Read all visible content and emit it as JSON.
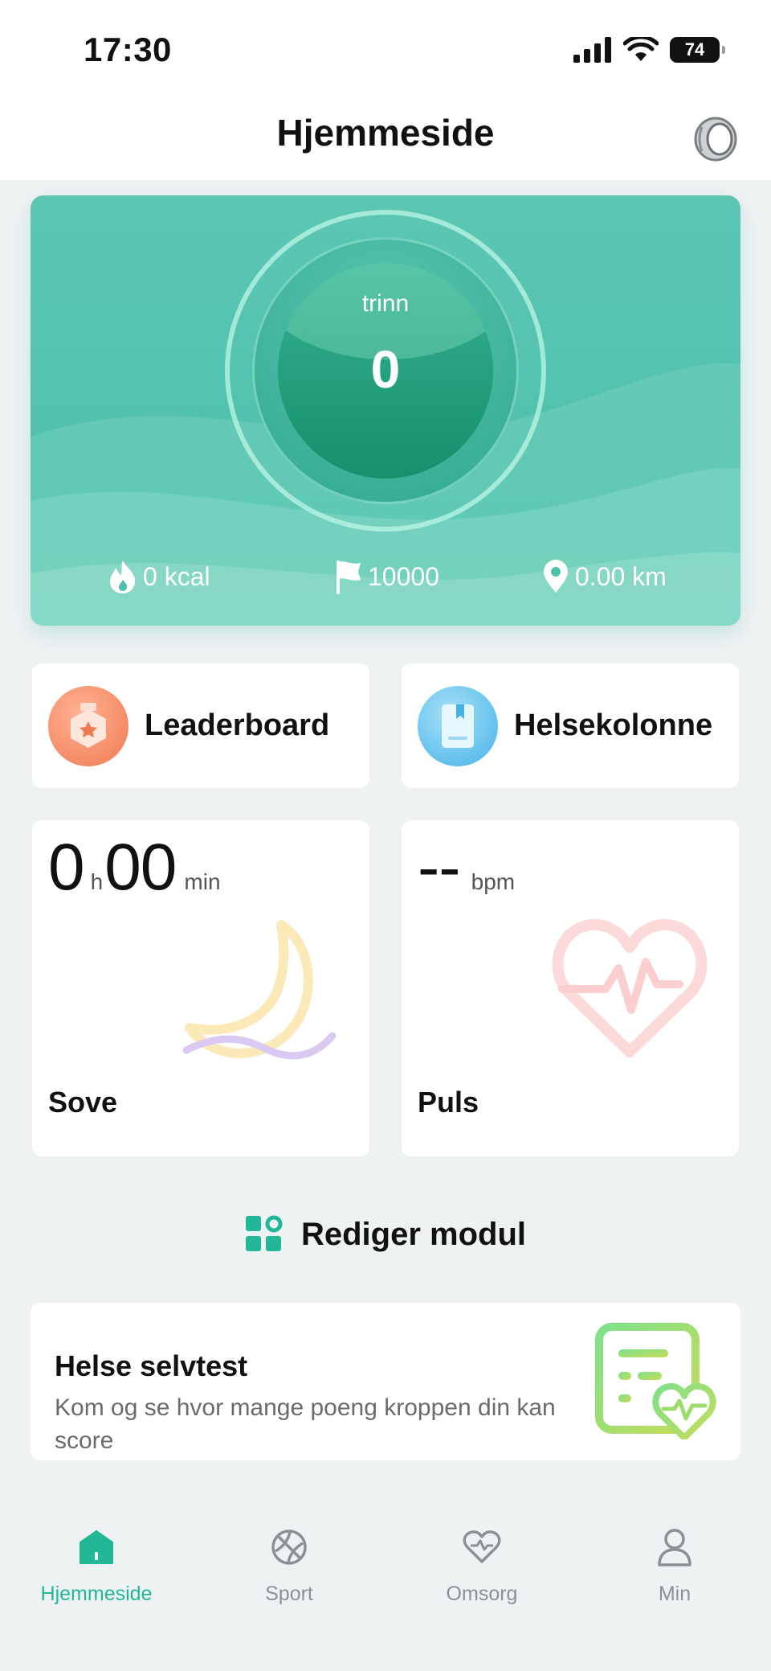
{
  "status_bar": {
    "time": "17:30",
    "battery": "74"
  },
  "header": {
    "title": "Hjemmeside",
    "ring_icon": "smart-ring-icon"
  },
  "steps_card": {
    "label": "trinn",
    "value": "0",
    "stats": [
      {
        "icon": "flame-icon",
        "text": "0 kcal"
      },
      {
        "icon": "flag-icon",
        "text": "10000"
      },
      {
        "icon": "location-pin-icon",
        "text": "0.00 km"
      }
    ]
  },
  "shortcuts": [
    {
      "label": "Leaderboard",
      "icon": "medal-icon"
    },
    {
      "label": "Helsekolonne",
      "icon": "book-icon"
    }
  ],
  "sleep": {
    "hours": "0",
    "hours_unit": "h",
    "minutes": "00",
    "minutes_unit": "min",
    "title": "Sove",
    "icon": "moon-icon"
  },
  "heart_rate": {
    "value": "--",
    "unit": "bpm",
    "title": "Puls",
    "icon": "heart-pulse-icon"
  },
  "edit_module": {
    "label": "Rediger modul",
    "icon": "grid-settings-icon"
  },
  "self_test": {
    "title": "Helse selvtest",
    "description": "Kom og se hvor mange poeng kroppen din kan score",
    "icon": "health-report-icon"
  },
  "tabs": [
    {
      "label": "Hjemmeside",
      "icon": "home-icon",
      "active": true
    },
    {
      "label": "Sport",
      "icon": "basketball-icon",
      "active": false
    },
    {
      "label": "Omsorg",
      "icon": "heart-icon",
      "active": false
    },
    {
      "label": "Min",
      "icon": "person-icon",
      "active": false
    }
  ],
  "colors": {
    "accent": "#22b796",
    "hero": "#4fc1ab",
    "background": "#eff2f3"
  }
}
